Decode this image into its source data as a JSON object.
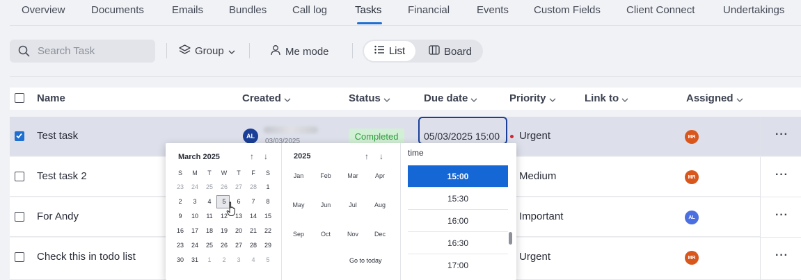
{
  "tabs": [
    "Overview",
    "Documents",
    "Emails",
    "Bundles",
    "Call log",
    "Tasks",
    "Financial",
    "Events",
    "Custom Fields",
    "Client Connect",
    "Undertakings"
  ],
  "active_tab": "Tasks",
  "toolbar": {
    "search_placeholder": "Search Task",
    "group_label": "Group",
    "me_mode_label": "Me mode",
    "list_label": "List",
    "board_label": "Board"
  },
  "columns": {
    "name": "Name",
    "created": "Created",
    "status": "Status",
    "due_date": "Due date",
    "priority": "Priority",
    "link_to": "Link to",
    "assigned": "Assigned"
  },
  "rows": [
    {
      "name": "Test task",
      "priority": "Urgent",
      "assignee": "MR",
      "checked": true,
      "created_initials": "AL",
      "created_date": "03/03/2025",
      "status": "Completed",
      "due": "05/03/2025 15:00"
    },
    {
      "name": "Test task 2",
      "priority": "Medium",
      "assignee": "MR",
      "checked": false
    },
    {
      "name": "For Andy",
      "priority": "Important",
      "assignee": "AL",
      "checked": false
    },
    {
      "name": "Check this in todo list",
      "priority": "Urgent",
      "assignee": "MR",
      "checked": false
    }
  ],
  "more_label": "···",
  "picker": {
    "calendar_title": "March 2025",
    "weekdays": [
      "S",
      "M",
      "T",
      "W",
      "T",
      "F",
      "S"
    ],
    "weeks": [
      [
        "23",
        "24",
        "25",
        "26",
        "27",
        "28",
        "1"
      ],
      [
        "2",
        "3",
        "4",
        "5",
        "6",
        "7",
        "8"
      ],
      [
        "9",
        "10",
        "11",
        "12",
        "13",
        "14",
        "15"
      ],
      [
        "16",
        "17",
        "18",
        "19",
        "20",
        "21",
        "22"
      ],
      [
        "23",
        "24",
        "25",
        "26",
        "27",
        "28",
        "29"
      ],
      [
        "30",
        "31",
        "1",
        "2",
        "3",
        "4",
        "5"
      ]
    ],
    "selected_day": "5",
    "year_title": "2025",
    "months": [
      "Jan",
      "Feb",
      "Mar",
      "Apr",
      "May",
      "Jun",
      "Jul",
      "Aug",
      "Sep",
      "Oct",
      "Nov",
      "Dec"
    ],
    "go_to_today": "Go to today",
    "time_title": "time",
    "times": [
      "15:00",
      "15:30",
      "16:00",
      "16:30",
      "17:00"
    ],
    "selected_time": "15:00"
  },
  "colors": {
    "accent": "#1f6fd1",
    "selected_time_bg": "#1467d4",
    "due_box_border": "#1b3f98",
    "status_completed_bg": "#d2f0d5",
    "status_completed_text": "#2e9a3e",
    "urgent_dot": "#d0263a",
    "avatar_mr": "#d9561c",
    "avatar_al": "#4b6fe0"
  },
  "icons": {
    "up": "↑",
    "down": "↓"
  }
}
